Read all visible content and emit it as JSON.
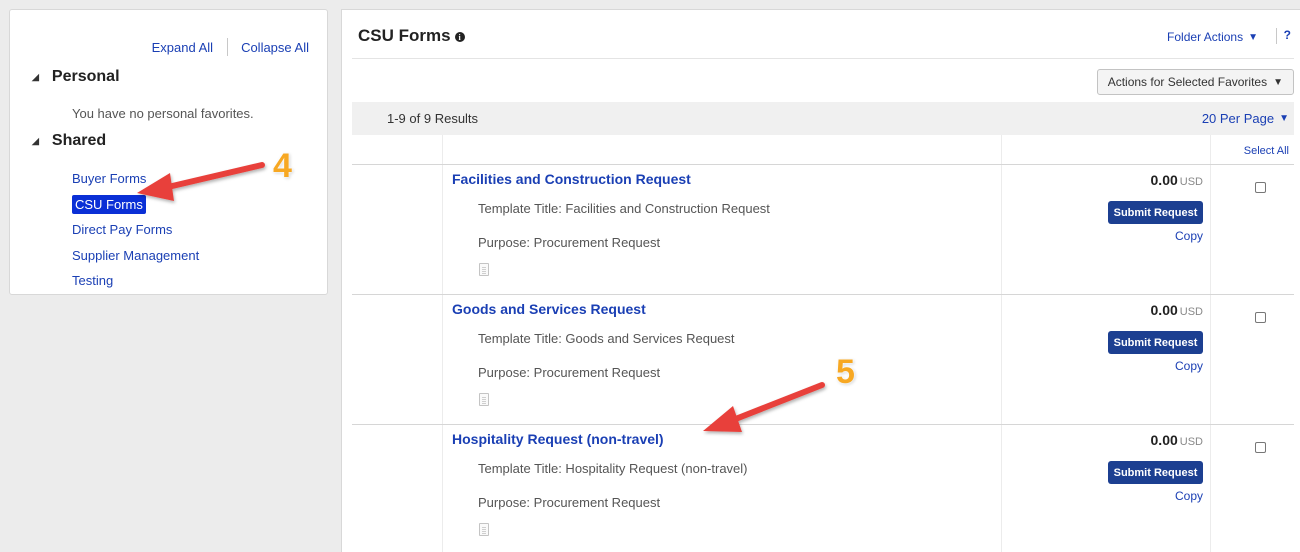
{
  "sidebar": {
    "expand_all": "Expand All",
    "collapse_all": "Collapse All",
    "personal": {
      "label": "Personal",
      "empty_text": "You have no personal favorites."
    },
    "shared": {
      "label": "Shared",
      "items": [
        {
          "label": "Buyer Forms",
          "active": false
        },
        {
          "label": "CSU Forms",
          "active": true
        },
        {
          "label": "Direct Pay Forms",
          "active": false
        },
        {
          "label": "Supplier Management",
          "active": false
        },
        {
          "label": "Testing",
          "active": false
        }
      ]
    }
  },
  "main": {
    "title": "CSU Forms",
    "info_icon_glyph": "i",
    "folder_actions": "Folder Actions",
    "help": "?",
    "actions_selected": "Actions for Selected Favorites",
    "results": "1-9 of 9 Results",
    "per_page": "20 Per Page",
    "select_all": "Select All",
    "rows": [
      {
        "title": "Facilities and Construction Request",
        "template_title": "Template Title: Facilities and Construction Request",
        "purpose": "Purpose: Procurement Request",
        "price": "0.00",
        "currency": "USD",
        "submit": "Submit Request",
        "copy": "Copy"
      },
      {
        "title": "Goods and Services Request",
        "template_title": "Template Title: Goods and Services Request",
        "purpose": "Purpose: Procurement Request",
        "price": "0.00",
        "currency": "USD",
        "submit": "Submit Request",
        "copy": "Copy"
      },
      {
        "title": "Hospitality Request (non-travel)",
        "template_title": "Template Title: Hospitality Request (non-travel)",
        "purpose": "Purpose: Procurement Request",
        "price": "0.00",
        "currency": "USD",
        "submit": "Submit Request",
        "copy": "Copy"
      }
    ]
  },
  "annotations": {
    "step_a": "4",
    "step_b": "5",
    "arrow_color": "#e8413a",
    "number_color": "#f7a823"
  },
  "colors": {
    "link": "#1a3fb4",
    "active_bg": "#0a2fd6",
    "submit_bg": "#1c3f91"
  }
}
